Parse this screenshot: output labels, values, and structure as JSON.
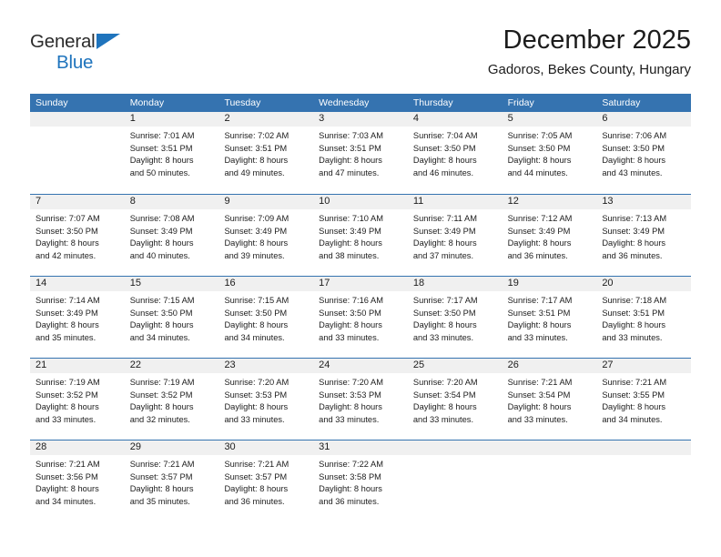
{
  "brand": {
    "name_top": "General",
    "name_bottom": "Blue",
    "accent_color": "#1f74bd"
  },
  "header": {
    "title": "December 2025",
    "subtitle": "Gadoros, Bekes County, Hungary"
  },
  "theme": {
    "header_blue": "#3573b0",
    "day_band_gray": "#f0f0f0",
    "text_color": "#1c1c1c"
  },
  "weekday_headers": [
    "Sunday",
    "Monday",
    "Tuesday",
    "Wednesday",
    "Thursday",
    "Friday",
    "Saturday"
  ],
  "weeks": [
    [
      {
        "day": "",
        "lines": []
      },
      {
        "day": "1",
        "lines": [
          "Sunrise: 7:01 AM",
          "Sunset: 3:51 PM",
          "Daylight: 8 hours",
          "and 50 minutes."
        ]
      },
      {
        "day": "2",
        "lines": [
          "Sunrise: 7:02 AM",
          "Sunset: 3:51 PM",
          "Daylight: 8 hours",
          "and 49 minutes."
        ]
      },
      {
        "day": "3",
        "lines": [
          "Sunrise: 7:03 AM",
          "Sunset: 3:51 PM",
          "Daylight: 8 hours",
          "and 47 minutes."
        ]
      },
      {
        "day": "4",
        "lines": [
          "Sunrise: 7:04 AM",
          "Sunset: 3:50 PM",
          "Daylight: 8 hours",
          "and 46 minutes."
        ]
      },
      {
        "day": "5",
        "lines": [
          "Sunrise: 7:05 AM",
          "Sunset: 3:50 PM",
          "Daylight: 8 hours",
          "and 44 minutes."
        ]
      },
      {
        "day": "6",
        "lines": [
          "Sunrise: 7:06 AM",
          "Sunset: 3:50 PM",
          "Daylight: 8 hours",
          "and 43 minutes."
        ]
      }
    ],
    [
      {
        "day": "7",
        "lines": [
          "Sunrise: 7:07 AM",
          "Sunset: 3:50 PM",
          "Daylight: 8 hours",
          "and 42 minutes."
        ]
      },
      {
        "day": "8",
        "lines": [
          "Sunrise: 7:08 AM",
          "Sunset: 3:49 PM",
          "Daylight: 8 hours",
          "and 40 minutes."
        ]
      },
      {
        "day": "9",
        "lines": [
          "Sunrise: 7:09 AM",
          "Sunset: 3:49 PM",
          "Daylight: 8 hours",
          "and 39 minutes."
        ]
      },
      {
        "day": "10",
        "lines": [
          "Sunrise: 7:10 AM",
          "Sunset: 3:49 PM",
          "Daylight: 8 hours",
          "and 38 minutes."
        ]
      },
      {
        "day": "11",
        "lines": [
          "Sunrise: 7:11 AM",
          "Sunset: 3:49 PM",
          "Daylight: 8 hours",
          "and 37 minutes."
        ]
      },
      {
        "day": "12",
        "lines": [
          "Sunrise: 7:12 AM",
          "Sunset: 3:49 PM",
          "Daylight: 8 hours",
          "and 36 minutes."
        ]
      },
      {
        "day": "13",
        "lines": [
          "Sunrise: 7:13 AM",
          "Sunset: 3:49 PM",
          "Daylight: 8 hours",
          "and 36 minutes."
        ]
      }
    ],
    [
      {
        "day": "14",
        "lines": [
          "Sunrise: 7:14 AM",
          "Sunset: 3:49 PM",
          "Daylight: 8 hours",
          "and 35 minutes."
        ]
      },
      {
        "day": "15",
        "lines": [
          "Sunrise: 7:15 AM",
          "Sunset: 3:50 PM",
          "Daylight: 8 hours",
          "and 34 minutes."
        ]
      },
      {
        "day": "16",
        "lines": [
          "Sunrise: 7:15 AM",
          "Sunset: 3:50 PM",
          "Daylight: 8 hours",
          "and 34 minutes."
        ]
      },
      {
        "day": "17",
        "lines": [
          "Sunrise: 7:16 AM",
          "Sunset: 3:50 PM",
          "Daylight: 8 hours",
          "and 33 minutes."
        ]
      },
      {
        "day": "18",
        "lines": [
          "Sunrise: 7:17 AM",
          "Sunset: 3:50 PM",
          "Daylight: 8 hours",
          "and 33 minutes."
        ]
      },
      {
        "day": "19",
        "lines": [
          "Sunrise: 7:17 AM",
          "Sunset: 3:51 PM",
          "Daylight: 8 hours",
          "and 33 minutes."
        ]
      },
      {
        "day": "20",
        "lines": [
          "Sunrise: 7:18 AM",
          "Sunset: 3:51 PM",
          "Daylight: 8 hours",
          "and 33 minutes."
        ]
      }
    ],
    [
      {
        "day": "21",
        "lines": [
          "Sunrise: 7:19 AM",
          "Sunset: 3:52 PM",
          "Daylight: 8 hours",
          "and 33 minutes."
        ]
      },
      {
        "day": "22",
        "lines": [
          "Sunrise: 7:19 AM",
          "Sunset: 3:52 PM",
          "Daylight: 8 hours",
          "and 32 minutes."
        ]
      },
      {
        "day": "23",
        "lines": [
          "Sunrise: 7:20 AM",
          "Sunset: 3:53 PM",
          "Daylight: 8 hours",
          "and 33 minutes."
        ]
      },
      {
        "day": "24",
        "lines": [
          "Sunrise: 7:20 AM",
          "Sunset: 3:53 PM",
          "Daylight: 8 hours",
          "and 33 minutes."
        ]
      },
      {
        "day": "25",
        "lines": [
          "Sunrise: 7:20 AM",
          "Sunset: 3:54 PM",
          "Daylight: 8 hours",
          "and 33 minutes."
        ]
      },
      {
        "day": "26",
        "lines": [
          "Sunrise: 7:21 AM",
          "Sunset: 3:54 PM",
          "Daylight: 8 hours",
          "and 33 minutes."
        ]
      },
      {
        "day": "27",
        "lines": [
          "Sunrise: 7:21 AM",
          "Sunset: 3:55 PM",
          "Daylight: 8 hours",
          "and 34 minutes."
        ]
      }
    ],
    [
      {
        "day": "28",
        "lines": [
          "Sunrise: 7:21 AM",
          "Sunset: 3:56 PM",
          "Daylight: 8 hours",
          "and 34 minutes."
        ]
      },
      {
        "day": "29",
        "lines": [
          "Sunrise: 7:21 AM",
          "Sunset: 3:57 PM",
          "Daylight: 8 hours",
          "and 35 minutes."
        ]
      },
      {
        "day": "30",
        "lines": [
          "Sunrise: 7:21 AM",
          "Sunset: 3:57 PM",
          "Daylight: 8 hours",
          "and 36 minutes."
        ]
      },
      {
        "day": "31",
        "lines": [
          "Sunrise: 7:22 AM",
          "Sunset: 3:58 PM",
          "Daylight: 8 hours",
          "and 36 minutes."
        ]
      },
      {
        "day": "",
        "lines": []
      },
      {
        "day": "",
        "lines": []
      },
      {
        "day": "",
        "lines": []
      }
    ]
  ]
}
